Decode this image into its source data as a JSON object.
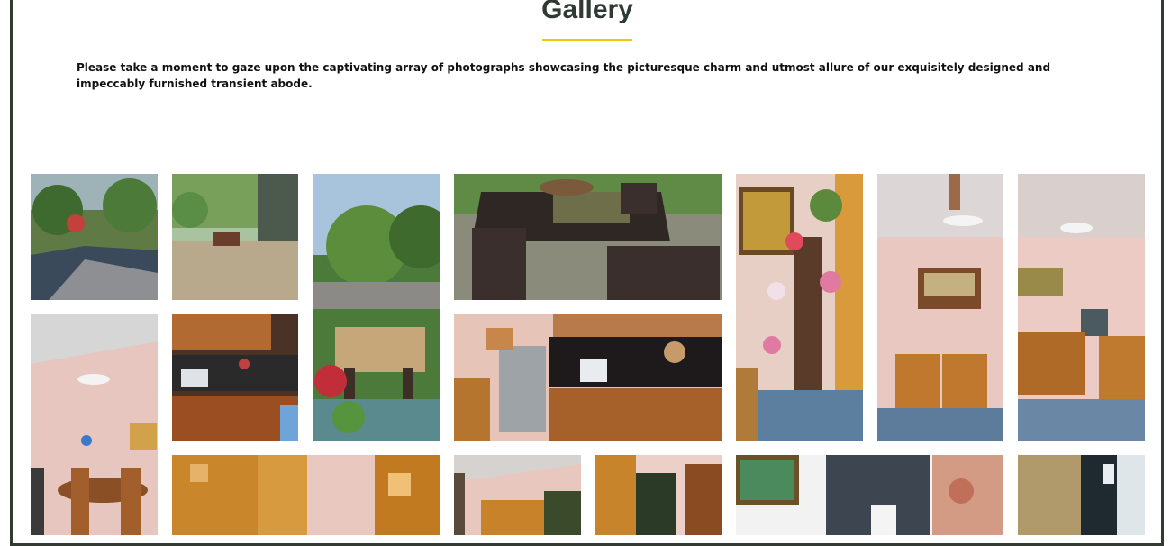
{
  "gallery": {
    "title": "Gallery",
    "description": "Please take a moment to gaze upon the captivating array of photographs showcasing the picturesque charm and utmost allure of our exquisitely designed and impeccably furnished transient abode.",
    "accent_color": "#f2c60c",
    "photos": [
      {
        "id": "photo-garden-path"
      },
      {
        "id": "photo-garden-patio"
      },
      {
        "id": "photo-outdoor-dining-tall"
      },
      {
        "id": "photo-outdoor-table"
      },
      {
        "id": "photo-plant-stand"
      },
      {
        "id": "photo-living-room-wide"
      },
      {
        "id": "photo-living-room-corner"
      },
      {
        "id": "photo-dining-room"
      },
      {
        "id": "photo-kitchen-cabinets"
      },
      {
        "id": "photo-kitchen-counter"
      },
      {
        "id": "photo-bedroom-curtains"
      },
      {
        "id": "photo-bedroom-window"
      },
      {
        "id": "photo-bedroom-bunk"
      },
      {
        "id": "photo-bathroom"
      },
      {
        "id": "photo-shower"
      }
    ]
  }
}
